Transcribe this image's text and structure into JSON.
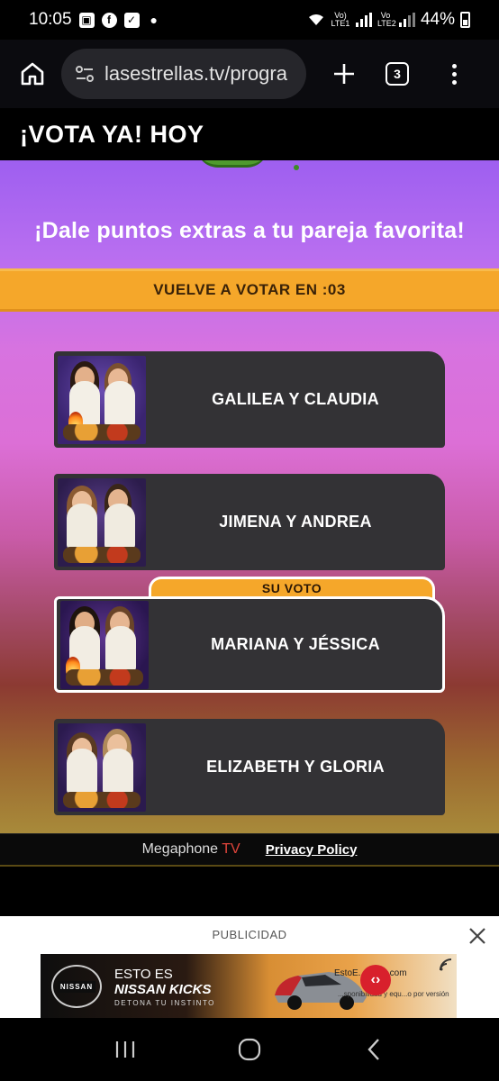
{
  "status_bar": {
    "time": "10:05",
    "notification_icons": [
      "gallery-icon",
      "facebook-icon",
      "checkbox-icon"
    ],
    "network_1": "Vo) LTE1",
    "network_2": "Vo LTE2",
    "battery": "44%"
  },
  "browser": {
    "url": "lasestrellas.tv/progra",
    "tab_count": "3"
  },
  "page": {
    "title": "¡VOTA YA! HOY"
  },
  "vote": {
    "subtitle": "¡Dale puntos extras a tu pareja favorita!",
    "timer_text": "VUELVE A VOTAR EN :03",
    "selected_label": "SU VOTO",
    "options": [
      {
        "name": "GALILEA Y CLAUDIA",
        "selected": false
      },
      {
        "name": "JIMENA Y ANDREA",
        "selected": false
      },
      {
        "name": "MARIANA Y JÉSSICA",
        "selected": true
      },
      {
        "name": "ELIZABETH Y GLORIA",
        "selected": false
      }
    ]
  },
  "footer": {
    "brand_text": "Megaphone",
    "brand_accent": "TV",
    "privacy_label": "Privacy Policy"
  },
  "ad": {
    "label": "PUBLICIDAD",
    "brand": "NISSAN",
    "headline_1": "ESTO ES",
    "headline_2": "NISSAN KICKS",
    "tagline": "DETONA TU INSTINTO",
    "url": "EstoE...Kicks.com",
    "disclaimer": "...sponibilidad y equ...o por versión"
  },
  "colors": {
    "accent_orange": "#f5a72a",
    "card_bg": "#333235",
    "brand_tv_red": "#e0453b"
  }
}
